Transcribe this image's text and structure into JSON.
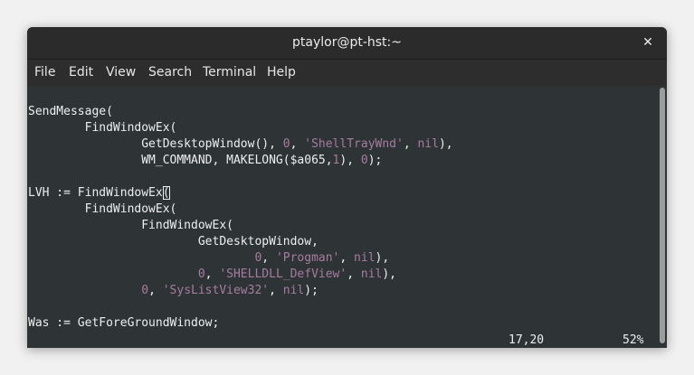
{
  "window": {
    "title": "ptaylor@pt-hst:~",
    "close_glyph": "✕"
  },
  "menu": [
    "File",
    "Edit",
    "View",
    "Search",
    "Terminal",
    "Help"
  ],
  "code_lines": [
    [
      {
        "t": "SendMessage(",
        "k": "txt"
      }
    ],
    [
      {
        "t": "        FindWindowEx(",
        "k": "txt"
      }
    ],
    [
      {
        "t": "                GetDesktopWindow(), ",
        "k": "txt"
      },
      {
        "t": "0",
        "k": "num"
      },
      {
        "t": ", ",
        "k": "txt"
      },
      {
        "t": "'ShellTrayWnd'",
        "k": "str"
      },
      {
        "t": ", ",
        "k": "txt"
      },
      {
        "t": "nil",
        "k": "num"
      },
      {
        "t": "),",
        "k": "txt"
      }
    ],
    [
      {
        "t": "                WM_COMMAND, MAKELONG($a065,",
        "k": "txt"
      },
      {
        "t": "1",
        "k": "num"
      },
      {
        "t": "), ",
        "k": "txt"
      },
      {
        "t": "0",
        "k": "num"
      },
      {
        "t": ");",
        "k": "txt"
      }
    ],
    [],
    [
      {
        "t": "LVH := FindWindowEx",
        "k": "txt"
      },
      {
        "t": "(",
        "k": "cursor"
      }
    ],
    [
      {
        "t": "        FindWindowEx(",
        "k": "txt"
      }
    ],
    [
      {
        "t": "                FindWindowEx(",
        "k": "txt"
      }
    ],
    [
      {
        "t": "                        GetDesktopWindow,",
        "k": "txt"
      }
    ],
    [
      {
        "t": "                                ",
        "k": "txt"
      },
      {
        "t": "0",
        "k": "num"
      },
      {
        "t": ", ",
        "k": "txt"
      },
      {
        "t": "'Progman'",
        "k": "str"
      },
      {
        "t": ", ",
        "k": "txt"
      },
      {
        "t": "nil",
        "k": "num"
      },
      {
        "t": "),",
        "k": "txt"
      }
    ],
    [
      {
        "t": "                        ",
        "k": "txt"
      },
      {
        "t": "0",
        "k": "num"
      },
      {
        "t": ", ",
        "k": "txt"
      },
      {
        "t": "'SHELLDLL_DefView'",
        "k": "str"
      },
      {
        "t": ", ",
        "k": "txt"
      },
      {
        "t": "nil",
        "k": "num"
      },
      {
        "t": "),",
        "k": "txt"
      }
    ],
    [
      {
        "t": "                ",
        "k": "txt"
      },
      {
        "t": "0",
        "k": "num"
      },
      {
        "t": ", ",
        "k": "txt"
      },
      {
        "t": "'SysListView32'",
        "k": "str"
      },
      {
        "t": ", ",
        "k": "txt"
      },
      {
        "t": "nil",
        "k": "num"
      },
      {
        "t": ");",
        "k": "txt"
      }
    ],
    [],
    [
      {
        "t": "Was := GetForeGroundWindow;",
        "k": "txt"
      }
    ]
  ],
  "status": {
    "position": "17,20",
    "percent": "52%"
  },
  "colors": {
    "terminal_bg": "#2e3436",
    "text": "#eeeeee",
    "literal": "#a67ba0",
    "chrome_bg": "#2d2d2d"
  }
}
